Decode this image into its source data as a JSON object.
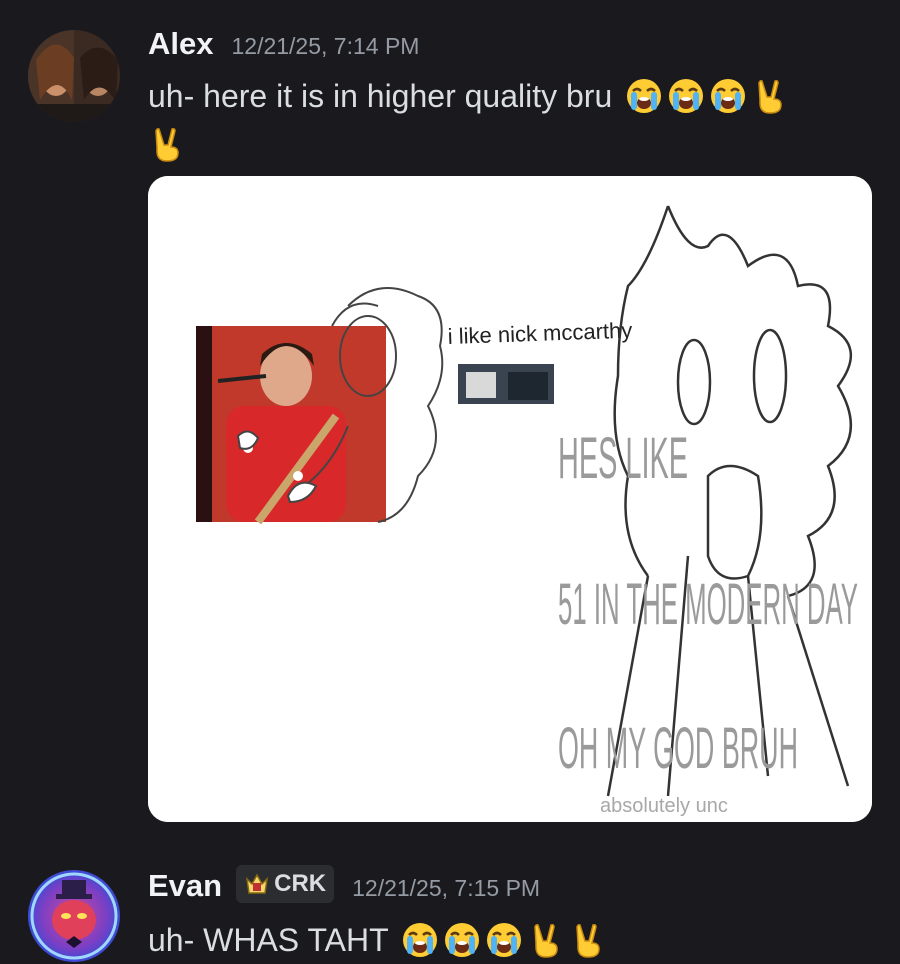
{
  "messages": [
    {
      "author": "Alex",
      "timestamp": "12/21/25, 7:14 PM",
      "text": "uh- here it is in higher quality bru",
      "emojis": [
        "loudly-crying-face",
        "loudly-crying-face",
        "loudly-crying-face",
        "victory-hand",
        "victory-hand"
      ],
      "attachment": {
        "caption_top": "i like nick mccarthy",
        "overlay_lines": [
          "HES LIKE",
          "51 IN THE MODERN DAY",
          "OH MY GOD BRUH"
        ],
        "footer": "absolutely unc"
      }
    },
    {
      "author": "Evan",
      "tag": "CRK",
      "timestamp": "12/21/25, 7:15 PM",
      "text": "uh- WHAS TAHT",
      "emojis": [
        "loudly-crying-face",
        "loudly-crying-face",
        "loudly-crying-face",
        "victory-hand",
        "victory-hand"
      ]
    }
  ],
  "colors": {
    "background": "#1a1a1e",
    "username": "#f2f3f5",
    "timestamp": "#949ba4",
    "text": "#dbdee1",
    "tag_bg": "#2b2d31"
  }
}
